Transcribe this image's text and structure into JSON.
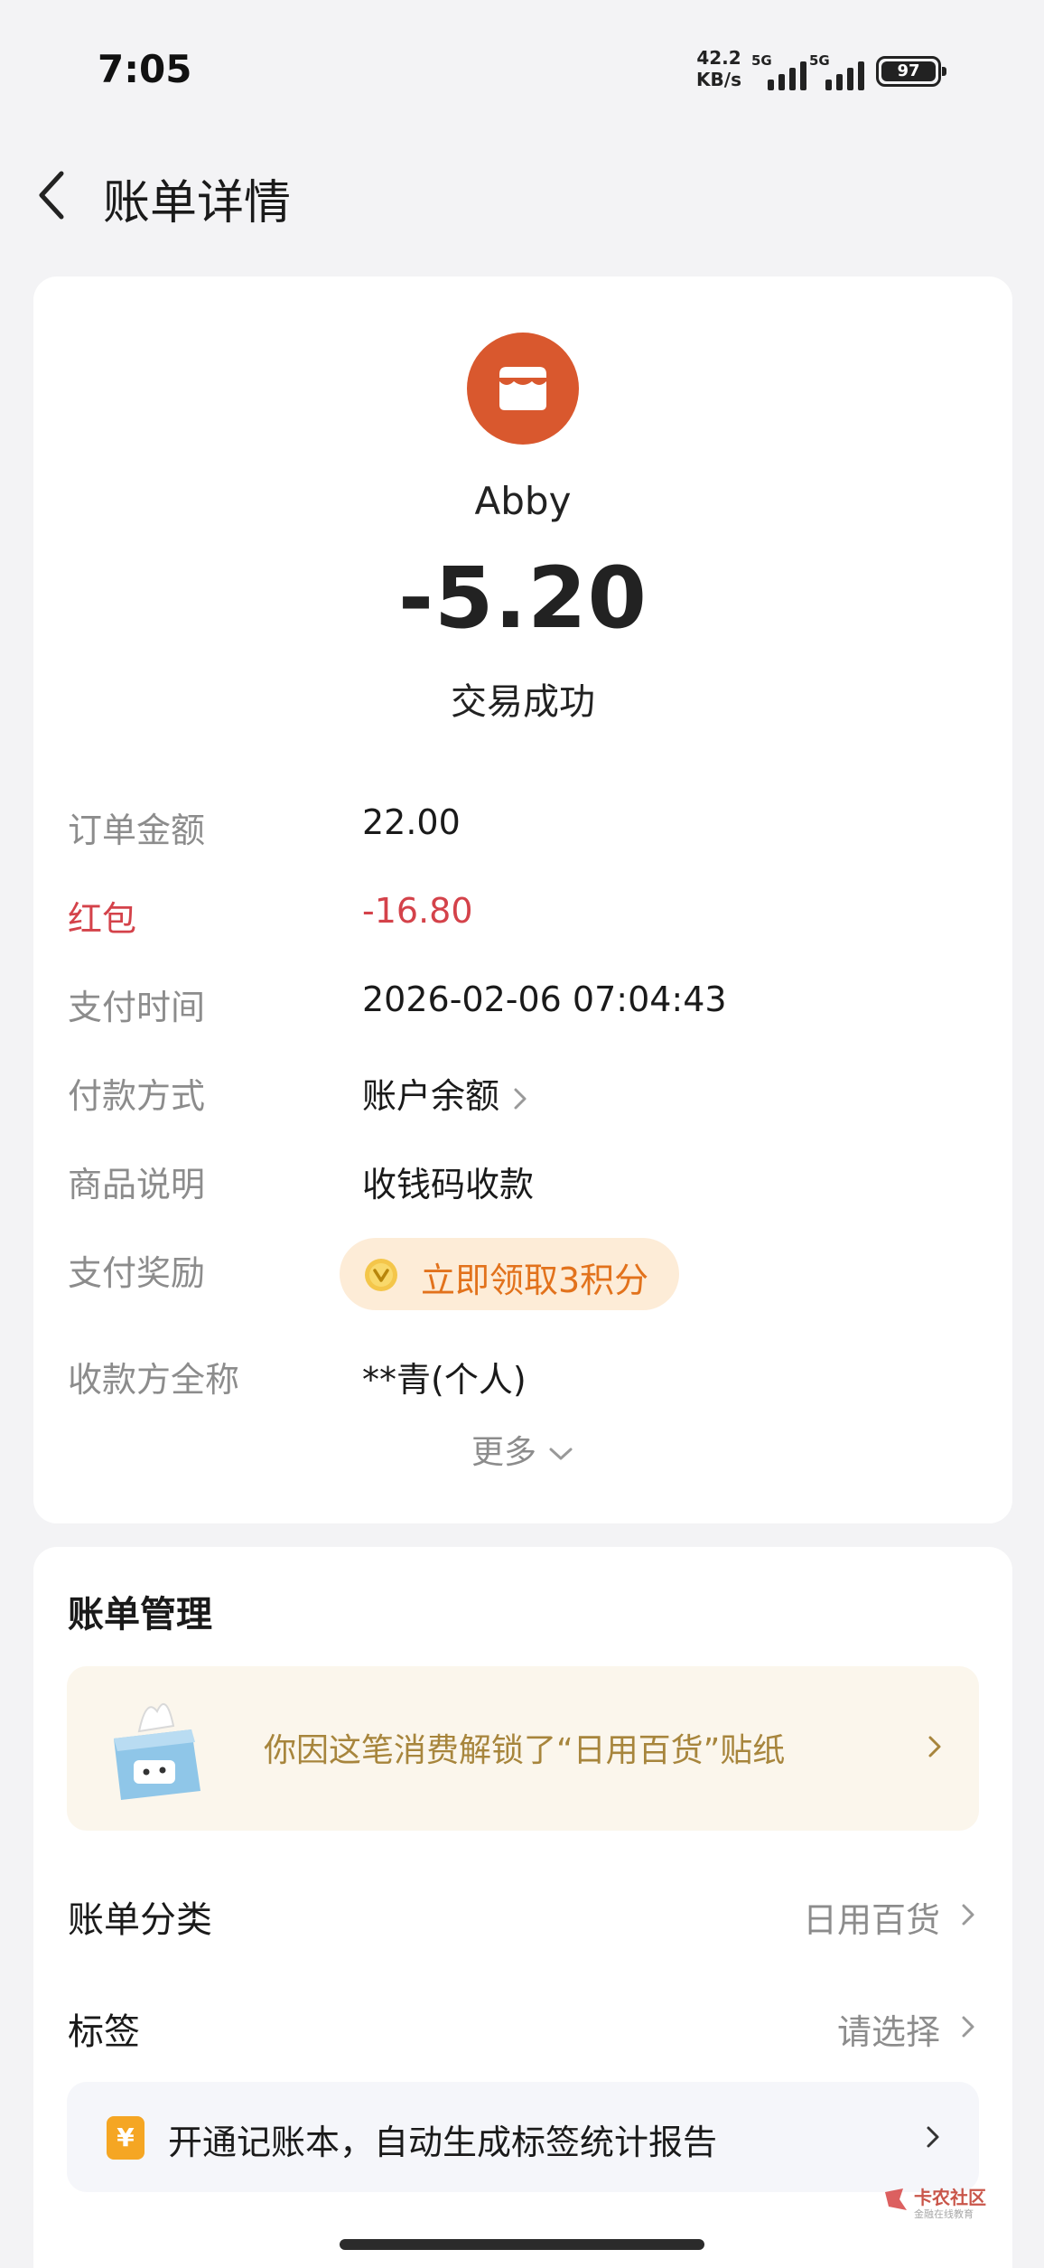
{
  "status_bar": {
    "time": "7:05",
    "net_speed_value": "42.2",
    "net_speed_unit": "KB/s",
    "signal_1_label": "5G",
    "signal_2_label": "5G",
    "battery_level": "97"
  },
  "header": {
    "title": "账单详情",
    "back_icon": "chevron-left-icon"
  },
  "transaction": {
    "merchant_icon": "store-icon",
    "merchant_color": "#d9582e",
    "merchant_name": "Abby",
    "amount": "-5.20",
    "status": "交易成功"
  },
  "details": [
    {
      "label": "订单金额",
      "value": "22.00"
    },
    {
      "label": "红包",
      "value": "-16.80"
    },
    {
      "label": "支付时间",
      "value": "2026-02-06 07:04:43"
    },
    {
      "label": "付款方式",
      "value": "账户余额"
    },
    {
      "label": "商品说明",
      "value": "收钱码收款"
    },
    {
      "label": "支付奖励",
      "value": "立即领取3积分"
    },
    {
      "label": "收款方全称",
      "value": "**青(个人)"
    }
  ],
  "more_label": "更多",
  "manage": {
    "title": "账单管理",
    "sticker_text": "你因这笔消费解锁了“日用百货”贴纸",
    "category_label": "账单分类",
    "category_value": "日用百货",
    "tag_label": "标签",
    "tag_value": "请选择",
    "ledger_icon_text": "¥",
    "ledger_text": "开通记账本，自动生成标签统计报告"
  },
  "watermark": {
    "title": "卡农社区",
    "subtitle": "金融在线教育"
  },
  "colors": {
    "accent_red": "#d4424a",
    "reward_orange": "#e2721c",
    "sticker_gold": "#a7853c"
  }
}
